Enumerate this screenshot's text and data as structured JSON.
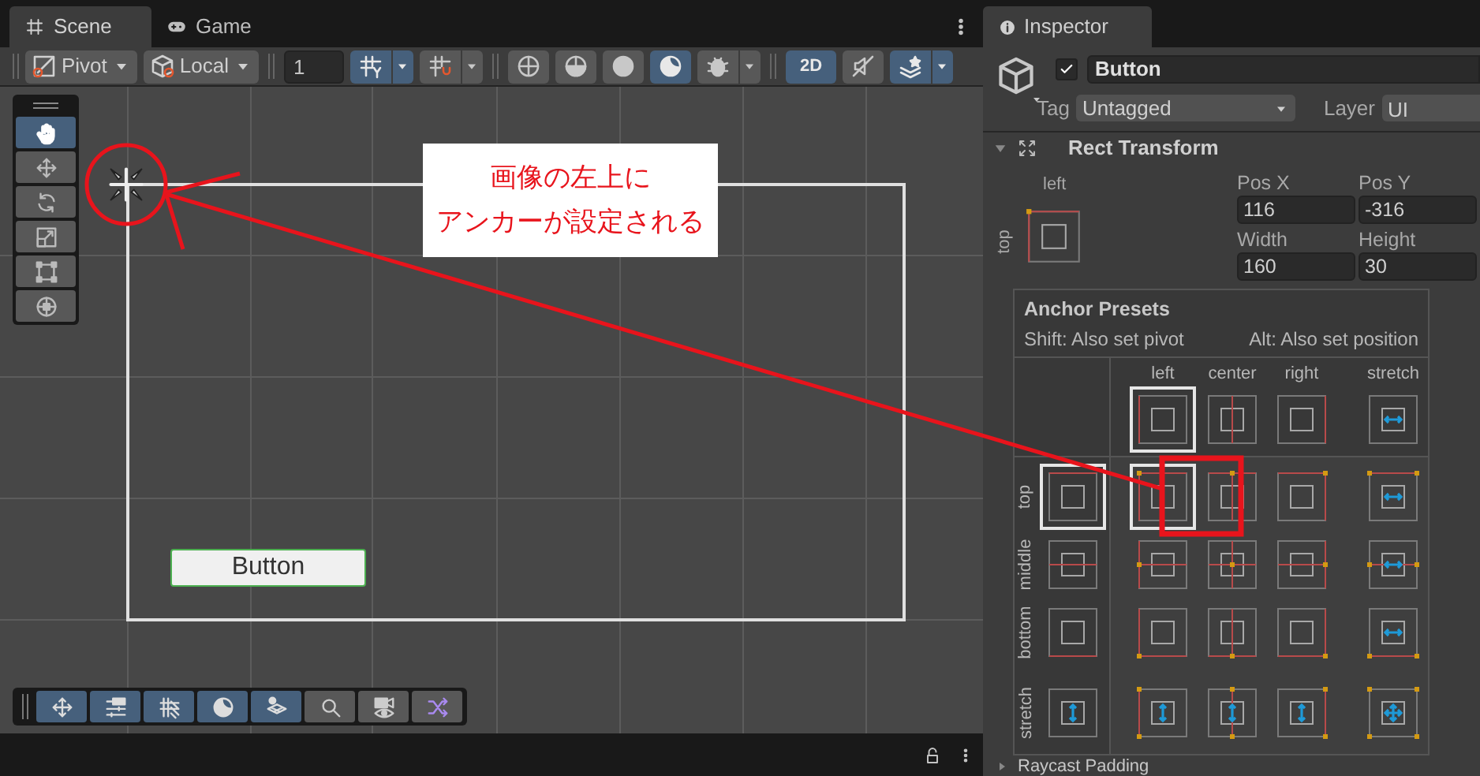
{
  "scene_tabs": [
    {
      "label": "Scene",
      "selected": true
    },
    {
      "label": "Game",
      "selected": false
    }
  ],
  "scene_toolbar": [
    {
      "kind": "dropdown",
      "label": "Pivot"
    },
    {
      "kind": "dropdown",
      "label": "Local"
    },
    {
      "kind": "separator"
    },
    {
      "kind": "field",
      "value": "1"
    },
    {
      "kind": "toggle",
      "selected": true,
      "caret": true
    },
    {
      "kind": "toggle",
      "selected": false,
      "caret": true
    },
    {
      "kind": "separator"
    },
    {
      "kind": "toggle",
      "selected": false,
      "caret": false
    },
    {
      "kind": "toggle",
      "selected": false,
      "caret": false
    },
    {
      "kind": "toggle",
      "selected": false,
      "caret": false
    },
    {
      "kind": "toggle",
      "selected": true,
      "caret": false
    },
    {
      "kind": "toggle",
      "selected": false,
      "caret": true
    },
    {
      "kind": "separator"
    },
    {
      "kind": "text-toggle",
      "label": "2D",
      "selected": true
    },
    {
      "kind": "toggle",
      "selected": false,
      "caret": false
    },
    {
      "kind": "toggle",
      "selected": true,
      "caret": true
    }
  ],
  "tools": [
    {
      "selected": true
    },
    {
      "selected": false
    },
    {
      "selected": false
    },
    {
      "selected": false
    },
    {
      "selected": false
    },
    {
      "selected": false
    }
  ],
  "scene": {
    "ui_button": {
      "label": "Button"
    }
  },
  "overlay_toolbar": [
    {
      "selected": true
    },
    {
      "selected": true
    },
    {
      "selected": true
    },
    {
      "selected": true
    },
    {
      "selected": true
    },
    {
      "selected": false
    },
    {
      "selected": false
    },
    {
      "selected": false
    }
  ],
  "annotation": {
    "lines": [
      "画像の左上に",
      "アンカーが設定される"
    ]
  },
  "inspector": {
    "tab": {
      "label": "Inspector"
    },
    "object": {
      "active": true,
      "name": "Button",
      "tag_label": "Tag",
      "tag": "Untagged",
      "layer_label": "Layer",
      "layer": "UI"
    },
    "rect_transform": {
      "title": "Rect Transform",
      "expanded": true,
      "anchor_h": "left",
      "anchor_v": "top",
      "fields": [
        {
          "label": "Pos X",
          "value": "116"
        },
        {
          "label": "Pos Y",
          "value": "-316"
        },
        {
          "label": "Width",
          "value": "160"
        },
        {
          "label": "Height",
          "value": "30"
        }
      ]
    },
    "next_section": {
      "title": "Raycast Padding"
    }
  },
  "anchor_presets": {
    "title": "Anchor Presets",
    "hints": [
      "Shift: Also set pivot",
      "Alt: Also set position"
    ],
    "columns": [
      {
        "label": "left",
        "kind": "left",
        "selected": true
      },
      {
        "label": "center",
        "kind": "center",
        "selected": false
      },
      {
        "label": "right",
        "kind": "right",
        "selected": false
      },
      {
        "label": "stretch",
        "kind": "stretch",
        "selected": false
      }
    ],
    "rows": [
      {
        "label": "top",
        "kind": "top",
        "selected": true,
        "cells": [
          {
            "selected": true
          },
          {
            "selected": false
          },
          {
            "selected": false
          },
          {
            "selected": false
          }
        ]
      },
      {
        "label": "middle",
        "kind": "middle",
        "selected": false,
        "cells": [
          {
            "selected": false
          },
          {
            "selected": false
          },
          {
            "selected": false
          },
          {
            "selected": false
          }
        ]
      },
      {
        "label": "bottom",
        "kind": "bottom",
        "selected": false,
        "cells": [
          {
            "selected": false
          },
          {
            "selected": false
          },
          {
            "selected": false
          },
          {
            "selected": false
          }
        ]
      },
      {
        "label": "stretch",
        "kind": "stretch",
        "selected": false,
        "cells": [
          {
            "selected": false
          },
          {
            "selected": false
          },
          {
            "selected": false
          },
          {
            "selected": false
          }
        ]
      }
    ]
  }
}
